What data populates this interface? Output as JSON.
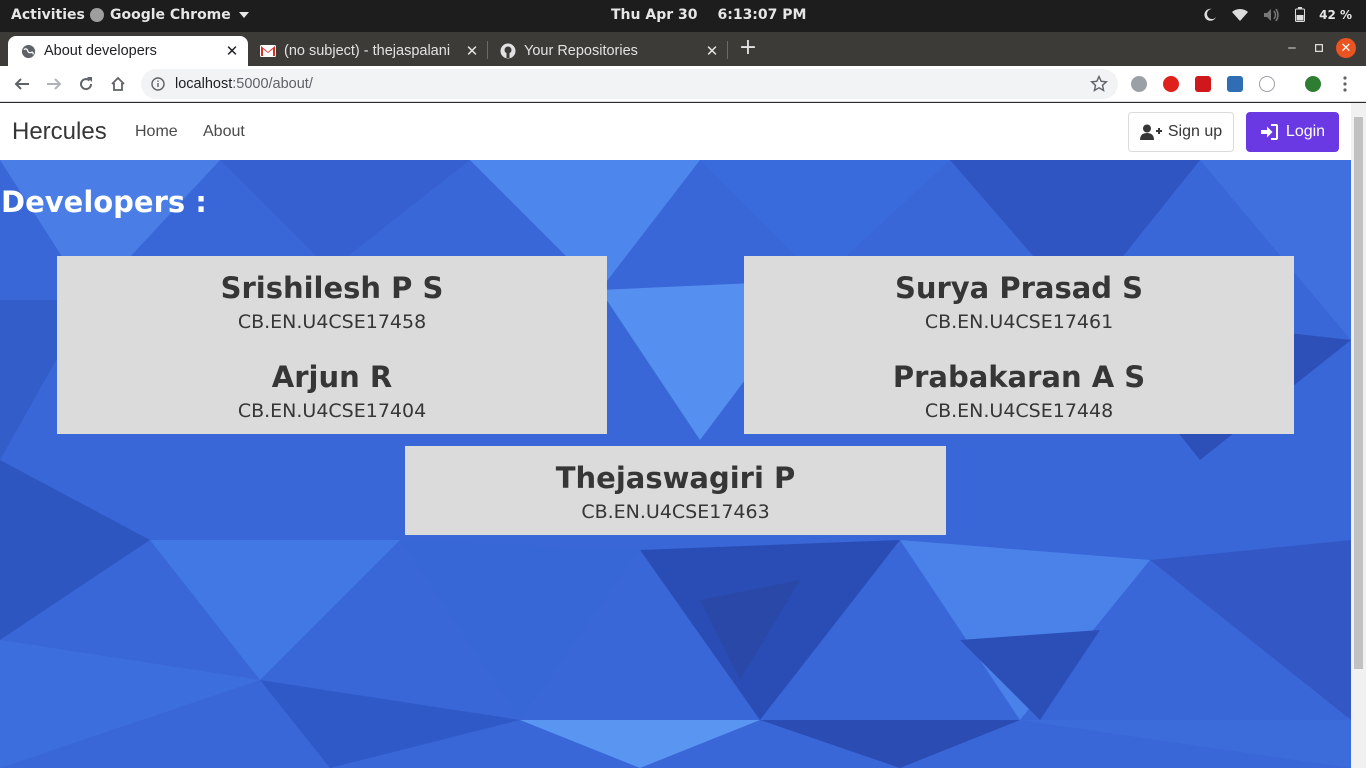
{
  "system": {
    "activities": "Activities",
    "app_name": "Google Chrome",
    "date": "Thu Apr 30",
    "time": "6:13:07 PM",
    "battery": "42 %"
  },
  "browser": {
    "tabs": [
      {
        "title": "About developers",
        "icon": "globe-icon",
        "active": true
      },
      {
        "title": "(no subject) - thejaspalani",
        "icon": "gmail-icon",
        "active": false
      },
      {
        "title": "Your Repositories",
        "icon": "github-icon",
        "active": false
      }
    ],
    "url_host": "localhost",
    "url_path": ":5000/about/"
  },
  "site": {
    "brand": "Hercules",
    "nav": {
      "home": "Home",
      "about": "About"
    },
    "signup": "Sign up",
    "login": "Login",
    "accent": "#6a39e4",
    "heading": "Developers :",
    "developers": [
      {
        "name": "Srishilesh P S",
        "roll": "CB.EN.U4CSE17458"
      },
      {
        "name": "Arjun R",
        "roll": "CB.EN.U4CSE17404"
      },
      {
        "name": "Surya Prasad S",
        "roll": "CB.EN.U4CSE17461"
      },
      {
        "name": "Prabakaran A S",
        "roll": "CB.EN.U4CSE17448"
      },
      {
        "name": "Thejaswagiri P",
        "roll": "CB.EN.U4CSE17463"
      }
    ]
  }
}
